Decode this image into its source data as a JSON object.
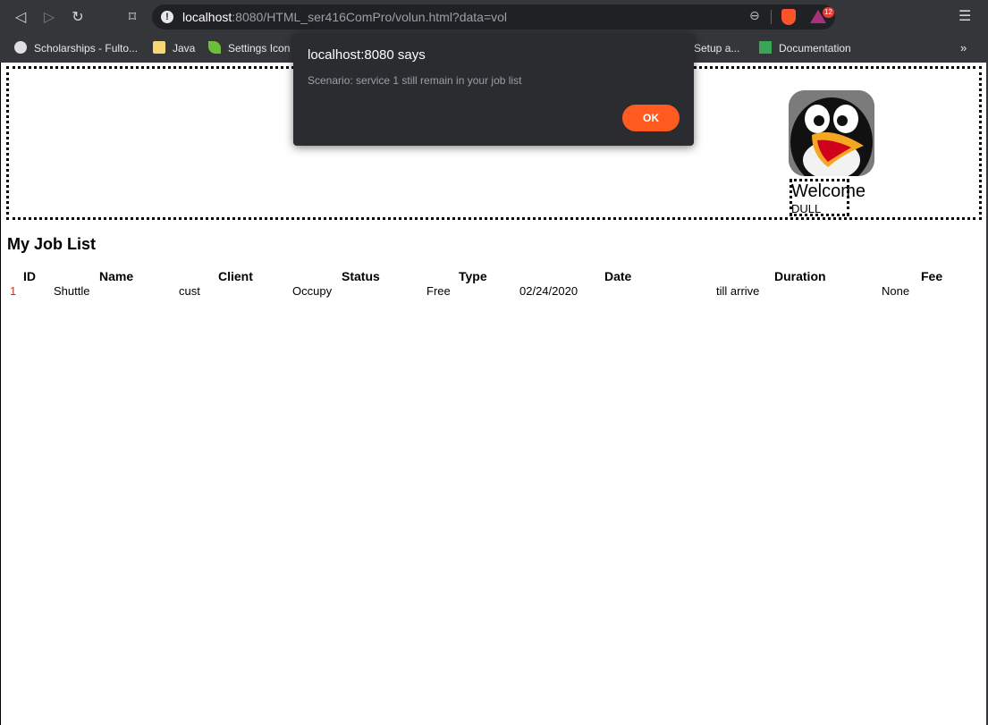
{
  "browser": {
    "url_host": "localhost",
    "url_rest": ":8080/HTML_ser416ComPro/volun.html?data=vol",
    "rewards_count": "12",
    "nav": {
      "back": "◁",
      "forward": "▷",
      "reload": "↻",
      "bookmark": "⌑",
      "menu": "☰",
      "zoom": "⊖"
    }
  },
  "bookmarks": {
    "items": [
      {
        "label": "Scholarships - Fulto...",
        "icon": "globe-icon"
      },
      {
        "label": "Java",
        "icon": "folder-icon"
      },
      {
        "label": "Settings Icon",
        "icon": "leaf-icon"
      },
      {
        "label": "Setup a...",
        "icon": "none"
      },
      {
        "label": "Documentation",
        "icon": "documentation-icon"
      }
    ],
    "more": "»"
  },
  "page": {
    "welcome": "Welcome",
    "user": "DULL",
    "job_list_title": "My Job List",
    "table": {
      "headers": [
        "ID",
        "Name",
        "Client",
        "Status",
        "Type",
        "Date",
        "Duration",
        "Fee"
      ],
      "rows": [
        [
          "1",
          "Shuttle",
          "cust",
          "Occupy",
          "Free",
          "02/24/2020",
          "till arrive",
          "None"
        ]
      ]
    }
  },
  "dialog": {
    "title": "localhost:8080 says",
    "message": "Scenario: service 1 still remain in your job list",
    "ok_label": "OK"
  },
  "colors": {
    "chrome": "#35363a",
    "dialog_bg": "#2b2c2f",
    "accent": "#ff5a1f",
    "id_color": "#d93025"
  }
}
